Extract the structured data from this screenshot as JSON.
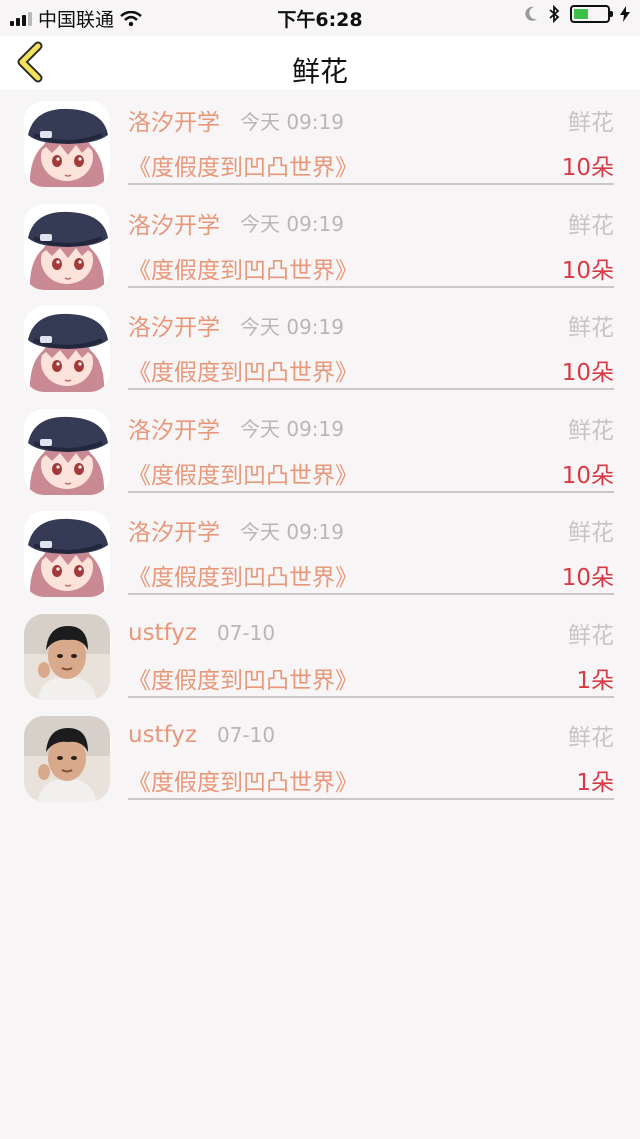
{
  "status_bar": {
    "carrier": "中国联通",
    "time": "下午6:28"
  },
  "nav": {
    "title": "鲜花"
  },
  "items": [
    {
      "name": "洛汐开学",
      "time": "今天 09:19",
      "gift": "鲜花",
      "book": "《度假度到凹凸世界》",
      "count": "10朵",
      "avatar": "anime-girl"
    },
    {
      "name": "洛汐开学",
      "time": "今天 09:19",
      "gift": "鲜花",
      "book": "《度假度到凹凸世界》",
      "count": "10朵",
      "avatar": "anime-girl"
    },
    {
      "name": "洛汐开学",
      "time": "今天 09:19",
      "gift": "鲜花",
      "book": "《度假度到凹凸世界》",
      "count": "10朵",
      "avatar": "anime-girl"
    },
    {
      "name": "洛汐开学",
      "time": "今天 09:19",
      "gift": "鲜花",
      "book": "《度假度到凹凸世界》",
      "count": "10朵",
      "avatar": "anime-girl"
    },
    {
      "name": "洛汐开学",
      "time": "今天 09:19",
      "gift": "鲜花",
      "book": "《度假度到凹凸世界》",
      "count": "10朵",
      "avatar": "anime-girl"
    },
    {
      "name": "ustfyz",
      "time": "07-10",
      "gift": "鲜花",
      "book": "《度假度到凹凸世界》",
      "count": "1朵",
      "avatar": "person-photo"
    },
    {
      "name": "ustfyz",
      "time": "07-10",
      "gift": "鲜花",
      "book": "《度假度到凹凸世界》",
      "count": "1朵",
      "avatar": "person-photo"
    }
  ],
  "colors": {
    "name": "#e8987a",
    "count": "#d73a47",
    "muted": "#b9b6b7",
    "background": "#f7f5f6"
  }
}
